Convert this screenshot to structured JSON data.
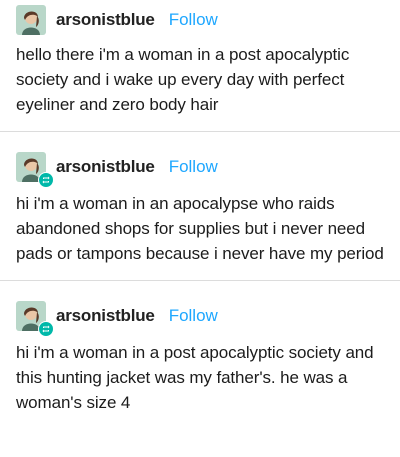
{
  "posts": [
    {
      "username": "arsonistblue",
      "follow_label": "Follow",
      "reblog": false,
      "text": "hello there i'm a woman in a post apocalyptic society and i wake up every day with perfect eyeliner and zero body hair"
    },
    {
      "username": "arsonistblue",
      "follow_label": "Follow",
      "reblog": true,
      "text": "hi i'm a woman in an apocalypse who raids abandoned shops for supplies but i never need pads or tampons because i never have my period"
    },
    {
      "username": "arsonistblue",
      "follow_label": "Follow",
      "reblog": true,
      "text": "hi i'm a woman in a post apocalyptic society and this hunting jacket was my father's. he was a woman's size 4"
    }
  ],
  "colors": {
    "follow": "#1ea7ff",
    "reblog_badge": "#00b8a9",
    "divider": "#dcdcdc"
  },
  "icons": {
    "avatar": "avatar-illustration",
    "reblog": "reblog-icon"
  }
}
